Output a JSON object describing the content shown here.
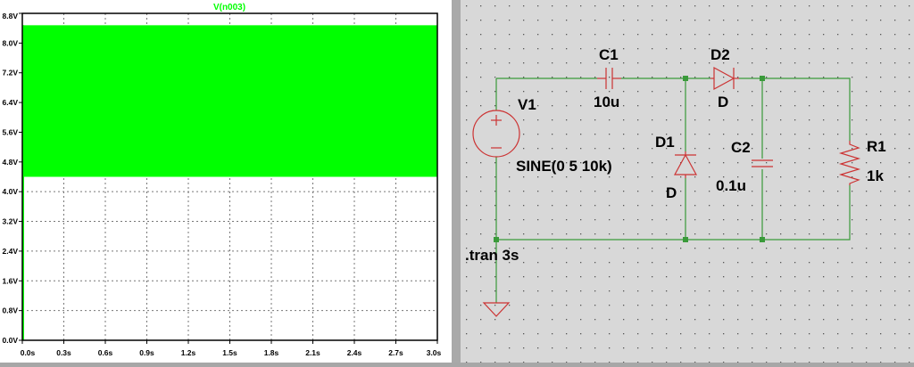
{
  "waveform": {
    "trace_name": "V(n003)",
    "trace_color": "#00ff00",
    "chart_data": {
      "type": "area",
      "title": "V(n003)",
      "xlabel": "",
      "ylabel": "",
      "xlim": [
        0,
        3
      ],
      "ylim": [
        0,
        8.8
      ],
      "x_ticks": [
        "0.0s",
        "0.3s",
        "0.6s",
        "0.9s",
        "1.2s",
        "1.5s",
        "1.8s",
        "2.1s",
        "2.4s",
        "2.7s",
        "3.0s"
      ],
      "y_ticks": [
        "0.0V",
        "0.8V",
        "1.6V",
        "2.4V",
        "3.2V",
        "4.0V",
        "4.8V",
        "5.6V",
        "6.4V",
        "7.2V",
        "8.0V",
        "8.8V"
      ],
      "y_tick_values": [
        0,
        0.8,
        1.6,
        2.4,
        3.2,
        4.0,
        4.8,
        5.6,
        6.4,
        7.2,
        8.0,
        8.8
      ],
      "x_tick_values": [
        0,
        0.3,
        0.6,
        0.9,
        1.2,
        1.5,
        1.8,
        2.1,
        2.4,
        2.7,
        3.0
      ],
      "grid": true,
      "series": [
        {
          "name": "V(n003)",
          "color": "#00ff00",
          "rise_start_y": 0,
          "rise_end_time": 0.003,
          "x": [
            0,
            3.0
          ],
          "y_min": [
            4.4,
            4.4
          ],
          "y_max": [
            8.48,
            8.48
          ]
        }
      ]
    }
  },
  "schematic": {
    "wire_color": "#2e8b2e",
    "component_color": "#cc3333",
    "label_color": "#000000",
    "components": {
      "v1": {
        "name": "V1",
        "value": "SINE(0 5 10k)"
      },
      "c1": {
        "name": "C1",
        "value": "10u"
      },
      "d2": {
        "name": "D2",
        "value": "D"
      },
      "d1": {
        "name": "D1",
        "value": "D"
      },
      "c2": {
        "name": "C2",
        "value": "0.1u"
      },
      "r1": {
        "name": "R1",
        "value": "1k"
      }
    },
    "directive": ".tran 3s"
  }
}
